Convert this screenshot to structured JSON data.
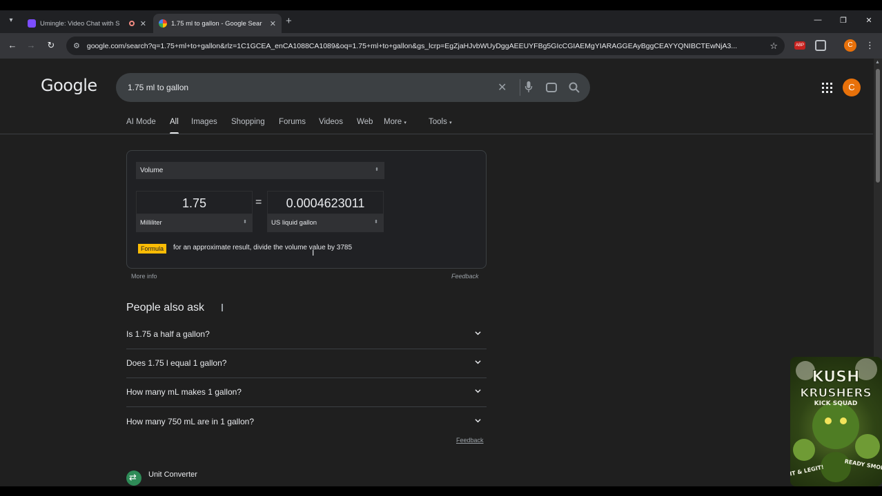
{
  "browser": {
    "tabs": [
      {
        "title": "Umingle: Video Chat with S",
        "active": false
      },
      {
        "title": "1.75 ml to gallon - Google Sear",
        "active": true
      }
    ],
    "url": "google.com/search?q=1.75+ml+to+gallon&rlz=1C1GCEA_enCA1088CA1089&oq=1.75+ml+to+gallon&gs_lcrp=EgZjaHJvbWUyDggAEEUYFBg5GIcCGIAEMgYIARAGGEAyBggCEAYYQNIBCTEwNjA3..."
  },
  "google": {
    "logo": "Google",
    "query": "1.75 ml to gallon",
    "avatar_letter": "C",
    "tabs": [
      "AI Mode",
      "All",
      "Images",
      "Shopping",
      "Forums",
      "Videos",
      "Web",
      "More",
      "Tools"
    ]
  },
  "converter": {
    "measure": "Volume",
    "from_value": "1.75",
    "equals": "=",
    "to_value": "0.0004623011",
    "from_unit": "Milliliter",
    "to_unit": "US liquid gallon",
    "formula_label": "Formula",
    "formula_text": "for an approximate result, divide the volume value by 3785",
    "more_info": "More info",
    "feedback": "Feedback"
  },
  "paa": {
    "title": "People also ask",
    "questions": [
      "Is 1.75 a half a gallon?",
      "Does 1.75 l equal 1 gallon?",
      "How many mL makes 1 gallon?",
      "How many 750 mL are in 1 gallon?"
    ],
    "feedback": "Feedback"
  },
  "result": {
    "title": "Unit Converter"
  },
  "overlay": {
    "line1": "KUSH",
    "line2": "KRUSHERS",
    "line3": "KICK SQUAD",
    "badge_left": "LIT & LEGIT!",
    "badge_right": "READY SMOKE!"
  },
  "colors": {
    "accent_yellow": "#fbbc05",
    "avatar_orange": "#e8710a",
    "page_bg": "#1f1f1f"
  }
}
